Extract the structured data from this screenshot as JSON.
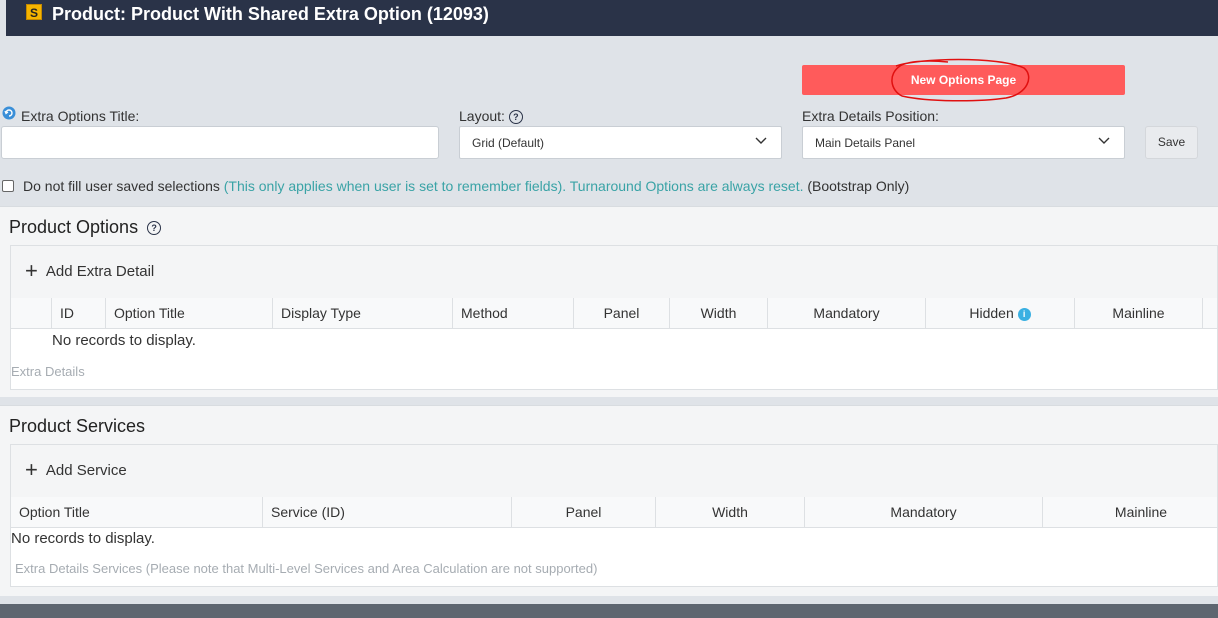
{
  "header": {
    "logo_letter": "S",
    "title": "Product: Product With Shared Extra Option (12093)"
  },
  "new_options_page_label": "New Options Page",
  "form": {
    "extra_options_title_label": "Extra Options Title:",
    "extra_options_title_value": "",
    "layout_label": "Layout:",
    "layout_value": "Grid (Default)",
    "extra_details_position_label": "Extra Details Position:",
    "extra_details_position_value": "Main Details Panel",
    "save_label": "Save",
    "checkbox_checked": false,
    "checkbox_label_prefix": "Do not fill user saved selections",
    "checkbox_label_note": "(This only applies when user is set to remember fields). Turnaround Options are always reset.",
    "checkbox_label_suffix": "(Bootstrap Only)"
  },
  "product_options": {
    "heading": "Product Options",
    "add_label": "Add Extra Detail",
    "columns": [
      "",
      "ID",
      "Option Title",
      "Display Type",
      "Method",
      "Panel",
      "Width",
      "Mandatory",
      "Hidden",
      "Mainline"
    ],
    "empty_text": "No records to display.",
    "footnote": "Extra Details"
  },
  "product_services": {
    "heading": "Product Services",
    "add_label": "Add Service",
    "columns": [
      "Option Title",
      "Service (ID)",
      "Panel",
      "Width",
      "Mandatory",
      "Mainline"
    ],
    "empty_text": "No records to display.",
    "footnote": "Extra Details Services (Please note that Multi-Level Services and Area Calculation are not supported)"
  },
  "icons": {
    "help": "question-circle-icon",
    "info": "info-circle-icon",
    "refresh": "refresh-icon",
    "chevron": "chevron-down-icon",
    "plus": "plus-icon"
  },
  "colors": {
    "header_bg": "#2a3348",
    "new_page_btn": "#ff5b5b",
    "annotation": "#e01010",
    "teal_note": "#3aa3a6",
    "info_dot": "#3ab0e2"
  }
}
